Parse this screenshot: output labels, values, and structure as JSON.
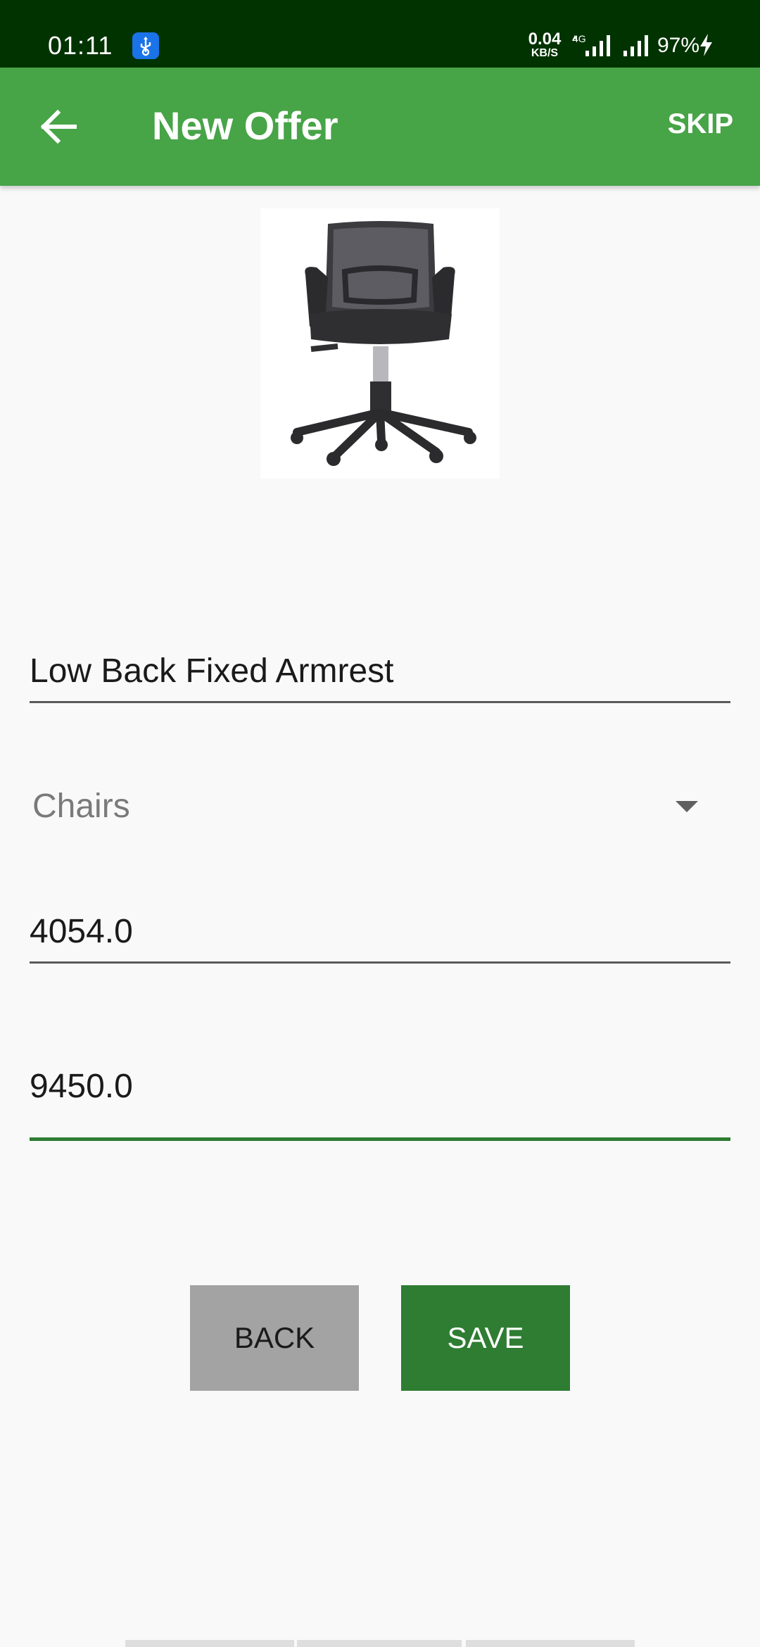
{
  "status_bar": {
    "time": "01:11",
    "net_speed_value": "0.04",
    "net_speed_unit": "KB/S",
    "network_type": "4G",
    "battery": "97%",
    "usb_icon": "usb-debug-icon",
    "charge_icon": "charging-bolt-icon"
  },
  "app_bar": {
    "title": "New Offer",
    "skip_label": "SKIP",
    "back_icon": "arrow-left-icon",
    "background_color": "#47a447"
  },
  "product": {
    "image": "office-chair-photo"
  },
  "form": {
    "name": "Low Back Fixed Armrest",
    "category": "Chairs",
    "price": "4054.0",
    "offer_price": "9450.0"
  },
  "buttons": {
    "back_label": "BACK",
    "save_label": "SAVE",
    "save_color": "#2e7d32",
    "back_color": "#a3a3a3"
  }
}
